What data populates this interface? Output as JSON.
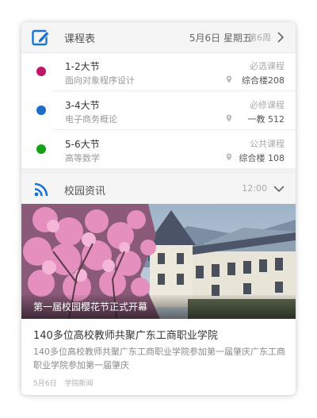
{
  "schedule": {
    "title": "课程表",
    "date": "5月6日 星期五",
    "week": "第6周",
    "icon": "edit-note-icon",
    "accent": "#1a74d6",
    "classes": [
      {
        "section": "1-2大节",
        "course": "面向对象程序设计",
        "type": "必选课程",
        "room": "综合楼208",
        "color": "#c0166a"
      },
      {
        "section": "3-4大节",
        "course": "电子商务概论",
        "type": "必修课程",
        "room": "一教 512",
        "color": "#1a6fcc"
      },
      {
        "section": "5-6大节",
        "course": "高等数学",
        "type": "公共课程",
        "room": "综合楼 108",
        "color": "#16a016"
      }
    ]
  },
  "news": {
    "title": "校园资讯",
    "time": "12:00",
    "icon": "rss-icon",
    "caption": "第一届校园樱花节正式开幕",
    "article_title": "140多位高校教师共聚广东工商职业学院",
    "article_body": "140多位高校教师共聚广东工商职业学院参加第一届肇庆广东工商职业学院参加第一届肇庆",
    "article_date": "5月6日",
    "article_source": "学院新闻"
  }
}
